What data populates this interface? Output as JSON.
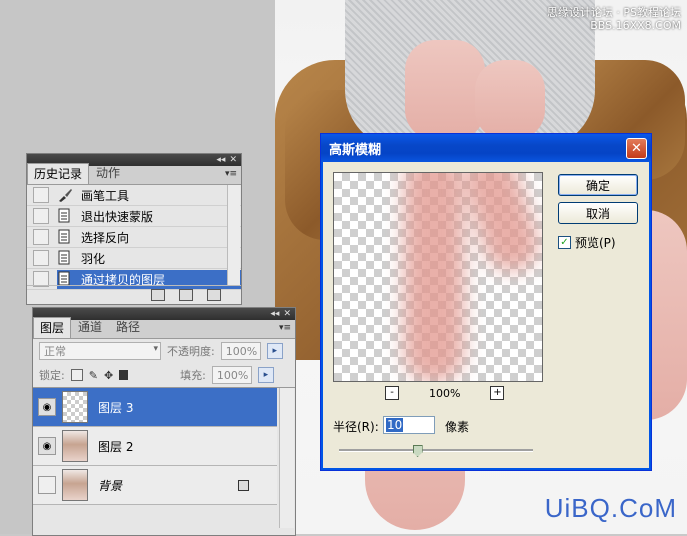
{
  "watermark": {
    "top_line1": "思缘设计论坛 · PS教程论坛",
    "top_line2": "BBS.16XX8.COM",
    "bottom": "UiBQ.CoM"
  },
  "history_panel": {
    "tabs": [
      "历史记录",
      "动作"
    ],
    "active_tab": "历史记录",
    "items": [
      {
        "label": "画笔工具",
        "icon": "brush-icon"
      },
      {
        "label": "退出快速蒙版",
        "icon": "history-state-icon"
      },
      {
        "label": "选择反向",
        "icon": "history-state-icon"
      },
      {
        "label": "羽化",
        "icon": "history-state-icon"
      },
      {
        "label": "通过拷贝的图层",
        "icon": "history-state-icon",
        "selected": true
      }
    ]
  },
  "layers_panel": {
    "tabs": [
      "图层",
      "通道",
      "路径"
    ],
    "active_tab": "图层",
    "blend_mode": "正常",
    "opacity_label": "不透明度:",
    "opacity_value": "100%",
    "lock_label": "锁定:",
    "fill_label": "填充:",
    "fill_value": "100%",
    "layers": [
      {
        "name": "图层 3",
        "visible": true,
        "selected": true,
        "thumb": "transparent"
      },
      {
        "name": "图层 2",
        "visible": true,
        "selected": false,
        "thumb": "photo"
      },
      {
        "name": "背景",
        "visible": false,
        "selected": false,
        "thumb": "photo",
        "locked": true
      }
    ]
  },
  "dialog": {
    "title": "高斯模糊",
    "ok_label": "确定",
    "cancel_label": "取消",
    "preview_label": "预览(P)",
    "preview_checked": true,
    "zoom_value": "100%",
    "zoom_out": "-",
    "zoom_in": "+",
    "radius_label": "半径(R):",
    "radius_value": "10",
    "radius_unit": "像素",
    "radius_slider_fraction": 0.4
  },
  "colors": {
    "selection_blue": "#3c6fc6",
    "xp_title_blue": "#0747c8",
    "watermark_blue": "#3a66c9"
  }
}
